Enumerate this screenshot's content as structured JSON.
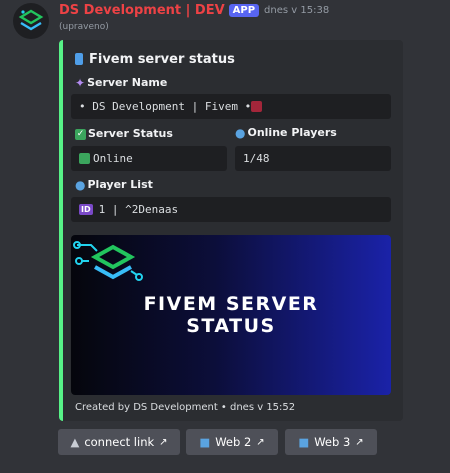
{
  "message": {
    "username": "DS Development | DEV",
    "app_badge": "APP",
    "timestamp": "dnes v 15:38",
    "edited": "(upraveno)"
  },
  "embed": {
    "accent_color": "#57f287",
    "title": "Fivem server status",
    "fields": {
      "server_name": {
        "label": "Server Name",
        "value": "•  DS Development | Fivem • "
      },
      "server_status": {
        "label": "Server Status",
        "value": "Online",
        "status_color": "#3ba55d"
      },
      "online_players": {
        "label": "Online Players",
        "value": "1/48"
      },
      "player_list": {
        "label": "Player List",
        "id_badge": "ID",
        "value": "1 | ^2Denaas"
      }
    },
    "banner": {
      "line1": "FIVEM SERVER",
      "line2": "STATUS"
    },
    "footer": "Created by DS Development • dnes v 15:52"
  },
  "buttons": [
    {
      "label": "connect link",
      "icon": "external-link-icon"
    },
    {
      "label": "Web 2",
      "icon": "external-link-icon"
    },
    {
      "label": "Web 3",
      "icon": "external-link-icon"
    }
  ]
}
